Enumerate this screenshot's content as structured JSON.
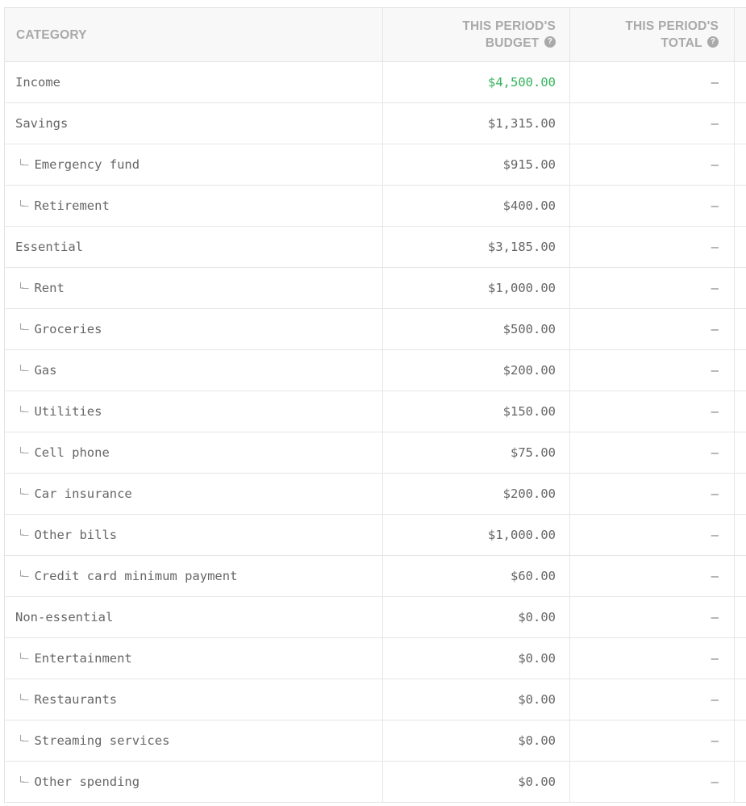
{
  "table": {
    "headers": {
      "category": "CATEGORY",
      "budget_line1": "THIS PERIOD'S",
      "budget_line2": "BUDGET",
      "total_line1": "THIS PERIOD'S",
      "total_line2": "TOTAL",
      "help_glyph": "?"
    },
    "branch_glyph": "└–",
    "rows": [
      {
        "label": "Income",
        "budget": "$4,500.00",
        "total": "–"
      },
      {
        "label": "Savings",
        "budget": "$1,315.00",
        "total": "–"
      },
      {
        "label": "Emergency fund",
        "budget": "$915.00",
        "total": "–"
      },
      {
        "label": "Retirement",
        "budget": "$400.00",
        "total": "–"
      },
      {
        "label": "Essential",
        "budget": "$3,185.00",
        "total": "–"
      },
      {
        "label": "Rent",
        "budget": "$1,000.00",
        "total": "–"
      },
      {
        "label": "Groceries",
        "budget": "$500.00",
        "total": "–"
      },
      {
        "label": "Gas",
        "budget": "$200.00",
        "total": "–"
      },
      {
        "label": "Utilities",
        "budget": "$150.00",
        "total": "–"
      },
      {
        "label": "Cell phone",
        "budget": "$75.00",
        "total": "–"
      },
      {
        "label": "Car insurance",
        "budget": "$200.00",
        "total": "–"
      },
      {
        "label": "Other bills",
        "budget": "$1,000.00",
        "total": "–"
      },
      {
        "label": "Credit card minimum payment",
        "budget": "$60.00",
        "total": "–"
      },
      {
        "label": "Non-essential",
        "budget": "$0.00",
        "total": "–"
      },
      {
        "label": "Entertainment",
        "budget": "$0.00",
        "total": "–"
      },
      {
        "label": "Restaurants",
        "budget": "$0.00",
        "total": "–"
      },
      {
        "label": "Streaming services",
        "budget": "$0.00",
        "total": "–"
      },
      {
        "label": "Other spending",
        "budget": "$0.00",
        "total": "–"
      }
    ]
  },
  "colors": {
    "income_green": "#35b35c",
    "header_text": "#a9a9a9",
    "body_text": "#666666"
  }
}
